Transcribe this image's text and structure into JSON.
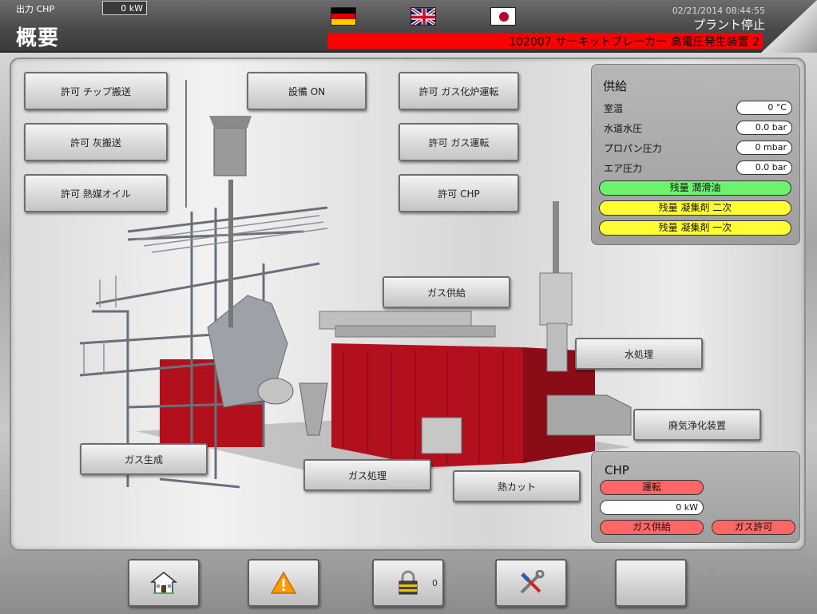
{
  "header": {
    "chp_output_label": "出力 CHP",
    "chp_output_value": "0 kW",
    "title": "概要",
    "datetime": "02/21/2014 08:44:55",
    "plant_status": "プラント停止",
    "alarm_message": "102007 サーキットブレーカー 高電圧発生装置 2",
    "alarm_color": "#ff0000",
    "flags": [
      "german-flag-icon",
      "uk-flag-icon",
      "japan-flag-icon"
    ]
  },
  "buttons": {
    "permit_chip_transport": "許可 チップ搬送",
    "permit_ash_transport": "許可 灰搬送",
    "permit_thermal_oil": "許可 熱媒オイル",
    "equipment_on": "設備 ON",
    "permit_gasifier": "許可 ガス化炉運転",
    "permit_gas_operation": "許可 ガス運転",
    "permit_chp": "許可 CHP",
    "gas_supply": "ガス供給",
    "water_treatment": "水処理",
    "exhaust_purifier": "廃気浄化装置",
    "gas_generation": "ガス生成",
    "gas_processing": "ガス処理",
    "heat_cut": "熱カット"
  },
  "supply": {
    "title": "供給",
    "rows": [
      {
        "label": "室温",
        "value": "0 °C"
      },
      {
        "label": "水道水圧",
        "value": "0.0 bar"
      },
      {
        "label": "プロパン圧力",
        "value": "0 mbar"
      },
      {
        "label": "エア圧力",
        "value": "0.0 bar"
      }
    ],
    "indicators": [
      {
        "label": "残量 潤滑油",
        "color": "#6cf26c"
      },
      {
        "label": "残量 凝集剤 二次",
        "color": "#ffff33"
      },
      {
        "label": "残量 凝集剤 一次",
        "color": "#ffff33"
      }
    ]
  },
  "chp": {
    "title": "CHP",
    "running": "運転",
    "power": "0 kW",
    "gas_supply": "ガス供給",
    "gas_permit": "ガス許可",
    "status_color": "#ff6666"
  },
  "nav": {
    "home": "home-icon",
    "alarms": "warning-icon",
    "lock": "lock-icon",
    "lock_count": "0",
    "tools": "tools-icon",
    "empty": ""
  }
}
